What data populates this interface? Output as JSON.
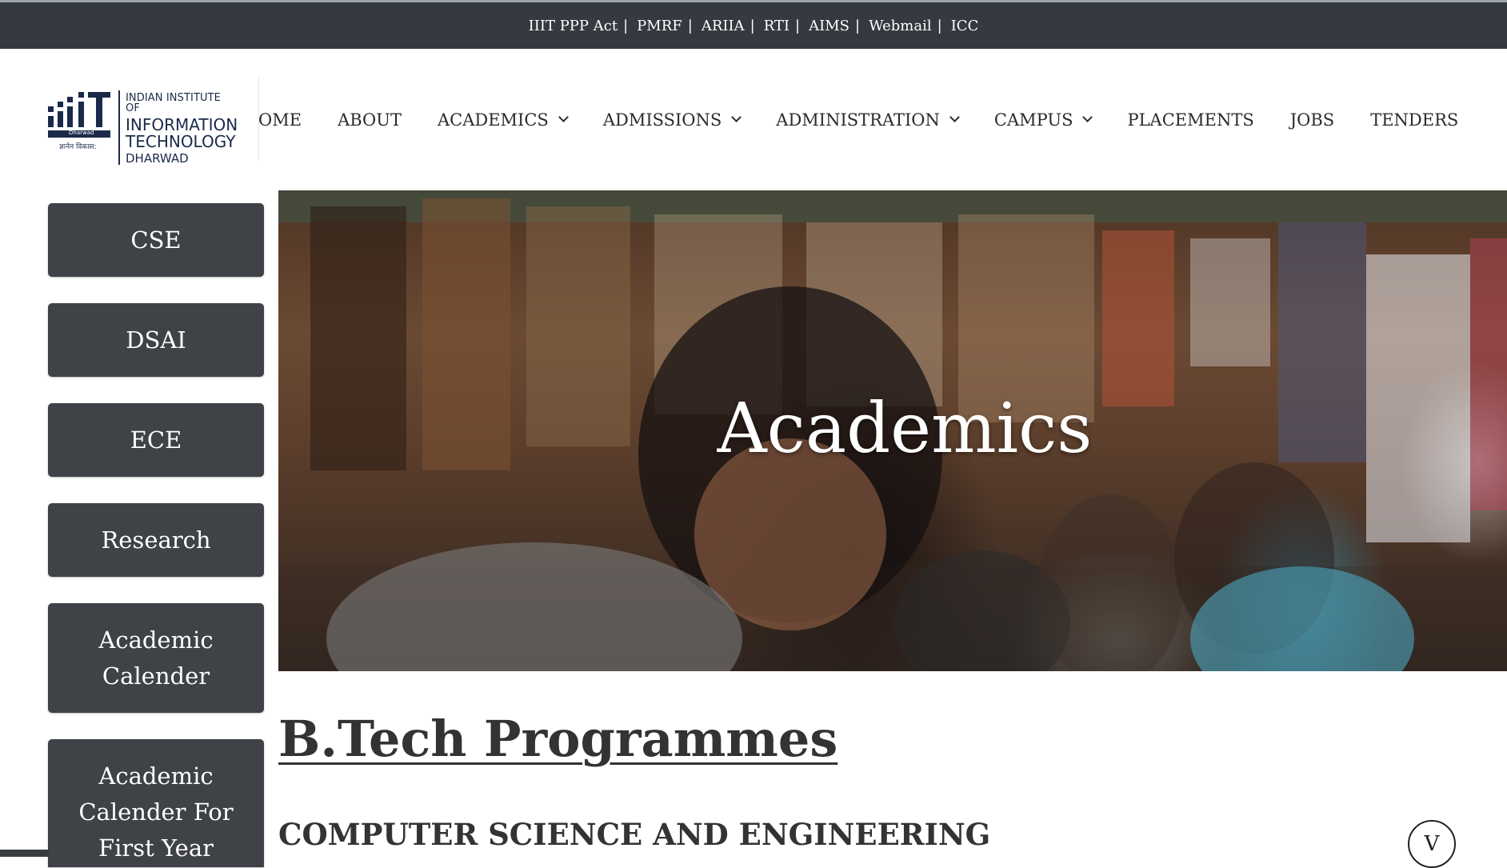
{
  "topbar": {
    "links": [
      {
        "label": "IIIT PPP Act"
      },
      {
        "label": "PMRF"
      },
      {
        "label": "ARIIA"
      },
      {
        "label": "RTI"
      },
      {
        "label": "AIMS"
      },
      {
        "label": "Webmail"
      },
      {
        "label": "ICC"
      }
    ],
    "separator": "|"
  },
  "logo": {
    "line1": "INDIAN INSTITUTE OF",
    "line2": "INFORMATION",
    "line3": "TECHNOLOGY",
    "line4": "DHARWAD",
    "mark_caption": "Dharwad",
    "mark_motto": "ज्ञानेन विकास:"
  },
  "nav": {
    "items": [
      {
        "label": "OME",
        "has_dropdown": false
      },
      {
        "label": "ABOUT",
        "has_dropdown": false
      },
      {
        "label": "ACADEMICS",
        "has_dropdown": true
      },
      {
        "label": "ADMISSIONS",
        "has_dropdown": true
      },
      {
        "label": "ADMINISTRATION",
        "has_dropdown": true
      },
      {
        "label": "CAMPUS",
        "has_dropdown": true
      },
      {
        "label": "PLACEMENTS",
        "has_dropdown": false
      },
      {
        "label": "JOBS",
        "has_dropdown": false
      },
      {
        "label": "TENDERS",
        "has_dropdown": false
      }
    ]
  },
  "sidebar": {
    "items": [
      {
        "label": "CSE"
      },
      {
        "label": "DSAI"
      },
      {
        "label": "ECE"
      },
      {
        "label": "Research"
      },
      {
        "label": "Academic Calender"
      },
      {
        "label": "Academic Calender For First Year"
      }
    ]
  },
  "hero": {
    "title": "Academics"
  },
  "content": {
    "programmes_heading": "B.Tech Programmes",
    "department_heading": "COMPUTER SCIENCE AND ENGINEERING",
    "toggle_label": "V"
  },
  "colors": {
    "topbar_bg": "#343a40",
    "sidebar_button_bg": "#3f4246",
    "logo_navy": "#1b2a4a",
    "heading_text": "#333333"
  }
}
